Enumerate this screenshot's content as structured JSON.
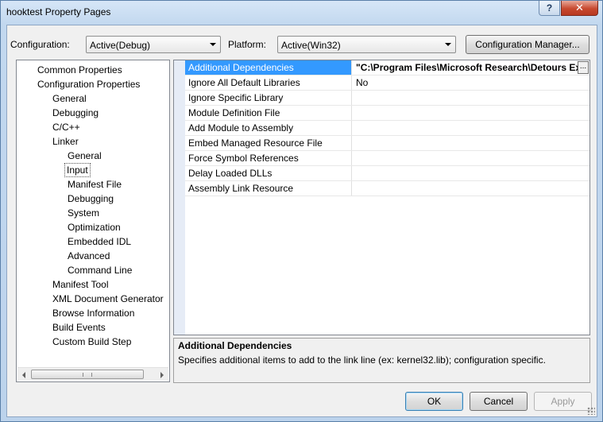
{
  "window": {
    "title": "hooktest Property Pages",
    "help_glyph": "?",
    "close_glyph": "✕"
  },
  "toolbar": {
    "configuration_label": "Configuration:",
    "configuration_value": "Active(Debug)",
    "platform_label": "Platform:",
    "platform_value": "Active(Win32)",
    "config_manager_label": "Configuration Manager..."
  },
  "tree": {
    "items": [
      {
        "label": "Common Properties"
      },
      {
        "label": "Configuration Properties"
      },
      {
        "label": "General"
      },
      {
        "label": "Debugging"
      },
      {
        "label": "C/C++"
      },
      {
        "label": "Linker"
      },
      {
        "label": "General"
      },
      {
        "label": "Input"
      },
      {
        "label": "Manifest File"
      },
      {
        "label": "Debugging"
      },
      {
        "label": "System"
      },
      {
        "label": "Optimization"
      },
      {
        "label": "Embedded IDL"
      },
      {
        "label": "Advanced"
      },
      {
        "label": "Command Line"
      },
      {
        "label": "Manifest Tool"
      },
      {
        "label": "XML Document Generator"
      },
      {
        "label": "Browse Information"
      },
      {
        "label": "Build Events"
      },
      {
        "label": "Custom Build Step"
      }
    ],
    "selected": "Input"
  },
  "grid": {
    "rows": [
      {
        "name": "Additional Dependencies",
        "value": "\"C:\\Program Files\\Microsoft Research\\Detours Exp"
      },
      {
        "name": "Ignore All Default Libraries",
        "value": "No"
      },
      {
        "name": "Ignore Specific Library",
        "value": ""
      },
      {
        "name": "Module Definition File",
        "value": ""
      },
      {
        "name": "Add Module to Assembly",
        "value": ""
      },
      {
        "name": "Embed Managed Resource File",
        "value": ""
      },
      {
        "name": "Force Symbol References",
        "value": ""
      },
      {
        "name": "Delay Loaded DLLs",
        "value": ""
      },
      {
        "name": "Assembly Link Resource",
        "value": ""
      }
    ],
    "ellipsis_label": "..."
  },
  "description": {
    "title": "Additional Dependencies",
    "text": "Specifies additional items to add to the link line (ex: kernel32.lib); configuration specific."
  },
  "buttons": {
    "ok": "OK",
    "cancel": "Cancel",
    "apply": "Apply"
  },
  "colors": {
    "selection": "#3399ff",
    "window_frame": "#bcd3ec",
    "close_button": "#c7492f"
  }
}
